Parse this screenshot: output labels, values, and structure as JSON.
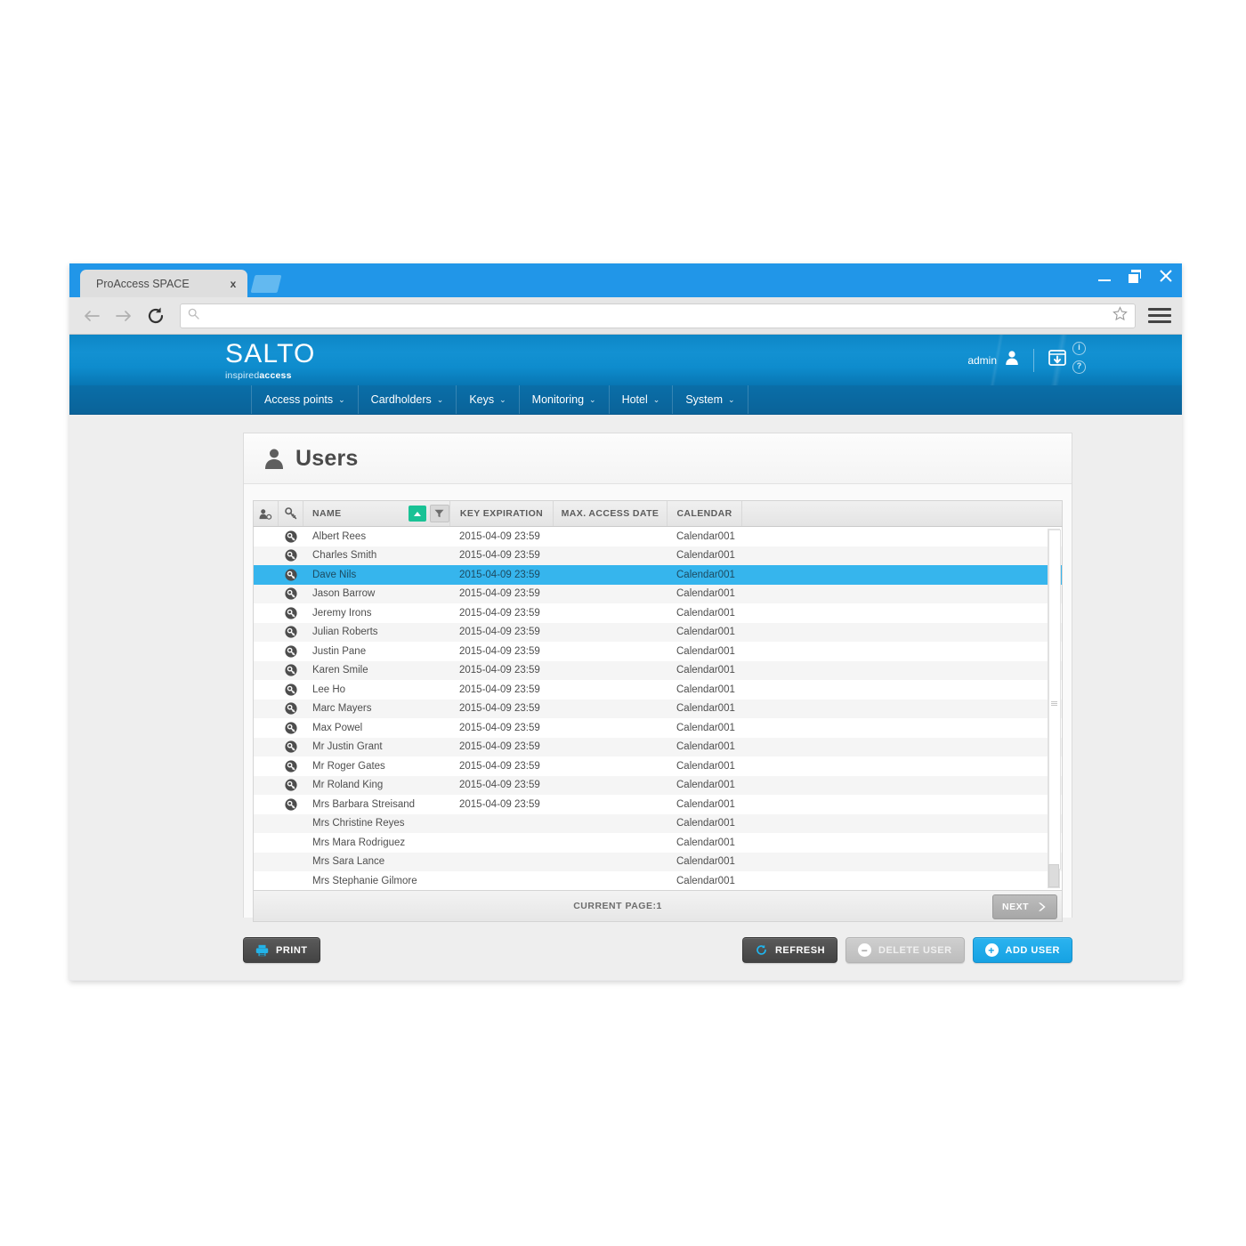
{
  "browser": {
    "tab_title": "ProAccess SPACE",
    "tab_close": "x",
    "url_value": "",
    "url_placeholder": "",
    "icons": {
      "back": "back-arrow-icon",
      "forward": "forward-arrow-icon",
      "reload": "reload-icon",
      "search": "search-icon",
      "bookmark": "star-icon",
      "menu": "hamburger-menu-icon",
      "minimize": "minimize-icon",
      "maximize": "maximize-icon",
      "close": "close-icon"
    }
  },
  "app": {
    "logo_mark": "SALTO",
    "logo_tag_light": "inspired",
    "logo_tag_bold": "access",
    "admin_label": "admin",
    "tiny_icons": [
      "i",
      "?"
    ],
    "nav": [
      {
        "label": "Access points",
        "caret": "⌄"
      },
      {
        "label": "Cardholders",
        "caret": "⌄"
      },
      {
        "label": "Keys",
        "caret": "⌄"
      },
      {
        "label": "Monitoring",
        "caret": "⌄"
      },
      {
        "label": "Hotel",
        "caret": "⌄"
      },
      {
        "label": "System",
        "caret": "⌄"
      }
    ],
    "page_title": "Users"
  },
  "grid": {
    "headers": {
      "col_user_key": "user-key-icon",
      "col_key": "key-icon",
      "name": "NAME",
      "sort": "sort-ascending-button",
      "filter": "filter-button",
      "key_expiration": "KEY EXPIRATION",
      "max_access_date": "MAX. ACCESS DATE",
      "calendar": "CALENDAR"
    },
    "rows": [
      {
        "key": true,
        "name": "Albert Rees",
        "key_expiration": "2015-04-09 23:59",
        "max_access_date": "",
        "calendar": "Calendar001",
        "selected": false
      },
      {
        "key": true,
        "name": "Charles Smith",
        "key_expiration": "2015-04-09 23:59",
        "max_access_date": "",
        "calendar": "Calendar001",
        "selected": false
      },
      {
        "key": true,
        "name": "Dave Nils",
        "key_expiration": "2015-04-09 23:59",
        "max_access_date": "",
        "calendar": "Calendar001",
        "selected": true
      },
      {
        "key": true,
        "name": "Jason Barrow",
        "key_expiration": "2015-04-09 23:59",
        "max_access_date": "",
        "calendar": "Calendar001",
        "selected": false
      },
      {
        "key": true,
        "name": "Jeremy Irons",
        "key_expiration": "2015-04-09 23:59",
        "max_access_date": "",
        "calendar": "Calendar001",
        "selected": false
      },
      {
        "key": true,
        "name": "Julian Roberts",
        "key_expiration": "2015-04-09 23:59",
        "max_access_date": "",
        "calendar": "Calendar001",
        "selected": false
      },
      {
        "key": true,
        "name": "Justin Pane",
        "key_expiration": "2015-04-09 23:59",
        "max_access_date": "",
        "calendar": "Calendar001",
        "selected": false
      },
      {
        "key": true,
        "name": "Karen Smile",
        "key_expiration": "2015-04-09 23:59",
        "max_access_date": "",
        "calendar": "Calendar001",
        "selected": false
      },
      {
        "key": true,
        "name": "Lee Ho",
        "key_expiration": "2015-04-09 23:59",
        "max_access_date": "",
        "calendar": "Calendar001",
        "selected": false
      },
      {
        "key": true,
        "name": "Marc Mayers",
        "key_expiration": "2015-04-09 23:59",
        "max_access_date": "",
        "calendar": "Calendar001",
        "selected": false
      },
      {
        "key": true,
        "name": "Max Powel",
        "key_expiration": "2015-04-09 23:59",
        "max_access_date": "",
        "calendar": "Calendar001",
        "selected": false
      },
      {
        "key": true,
        "name": "Mr Justin Grant",
        "key_expiration": "2015-04-09 23:59",
        "max_access_date": "",
        "calendar": "Calendar001",
        "selected": false
      },
      {
        "key": true,
        "name": "Mr Roger Gates",
        "key_expiration": "2015-04-09 23:59",
        "max_access_date": "",
        "calendar": "Calendar001",
        "selected": false
      },
      {
        "key": true,
        "name": "Mr Roland King",
        "key_expiration": "2015-04-09 23:59",
        "max_access_date": "",
        "calendar": "Calendar001",
        "selected": false
      },
      {
        "key": true,
        "name": "Mrs Barbara Streisand",
        "key_expiration": "2015-04-09 23:59",
        "max_access_date": "",
        "calendar": "Calendar001",
        "selected": false
      },
      {
        "key": false,
        "name": "Mrs Christine Reyes",
        "key_expiration": "",
        "max_access_date": "",
        "calendar": "Calendar001",
        "selected": false
      },
      {
        "key": false,
        "name": "Mrs Mara Rodriguez",
        "key_expiration": "",
        "max_access_date": "",
        "calendar": "Calendar001",
        "selected": false
      },
      {
        "key": false,
        "name": "Mrs Sara Lance",
        "key_expiration": "",
        "max_access_date": "",
        "calendar": "Calendar001",
        "selected": false
      },
      {
        "key": false,
        "name": "Mrs Stephanie Gilmore",
        "key_expiration": "",
        "max_access_date": "",
        "calendar": "Calendar001",
        "selected": false
      }
    ],
    "footer": {
      "current_page": "CURRENT PAGE:1",
      "next_label": "NEXT"
    }
  },
  "actions": {
    "print": "PRINT",
    "refresh": "REFRESH",
    "delete_user": "DELETE USER",
    "add_user": "ADD USER"
  },
  "colors": {
    "brand_blue": "#1391d2",
    "nav_blue": "#0a6899",
    "accent_blue": "#16a2e3",
    "selection_blue": "#36b5ed",
    "sort_green": "#19c295",
    "titlebar_blue": "#2196e8"
  }
}
